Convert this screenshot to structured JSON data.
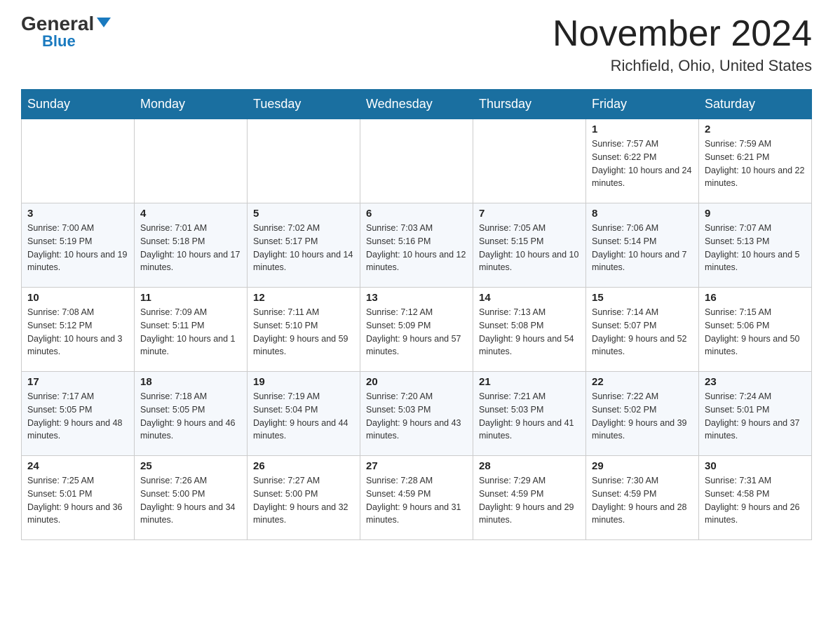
{
  "header": {
    "logo_text_general": "General",
    "logo_text_blue": "Blue",
    "page_title": "November 2024",
    "subtitle": "Richfield, Ohio, United States"
  },
  "calendar": {
    "days_of_week": [
      "Sunday",
      "Monday",
      "Tuesday",
      "Wednesday",
      "Thursday",
      "Friday",
      "Saturday"
    ],
    "weeks": [
      [
        {
          "day": "",
          "info": ""
        },
        {
          "day": "",
          "info": ""
        },
        {
          "day": "",
          "info": ""
        },
        {
          "day": "",
          "info": ""
        },
        {
          "day": "",
          "info": ""
        },
        {
          "day": "1",
          "info": "Sunrise: 7:57 AM\nSunset: 6:22 PM\nDaylight: 10 hours and 24 minutes."
        },
        {
          "day": "2",
          "info": "Sunrise: 7:59 AM\nSunset: 6:21 PM\nDaylight: 10 hours and 22 minutes."
        }
      ],
      [
        {
          "day": "3",
          "info": "Sunrise: 7:00 AM\nSunset: 5:19 PM\nDaylight: 10 hours and 19 minutes."
        },
        {
          "day": "4",
          "info": "Sunrise: 7:01 AM\nSunset: 5:18 PM\nDaylight: 10 hours and 17 minutes."
        },
        {
          "day": "5",
          "info": "Sunrise: 7:02 AM\nSunset: 5:17 PM\nDaylight: 10 hours and 14 minutes."
        },
        {
          "day": "6",
          "info": "Sunrise: 7:03 AM\nSunset: 5:16 PM\nDaylight: 10 hours and 12 minutes."
        },
        {
          "day": "7",
          "info": "Sunrise: 7:05 AM\nSunset: 5:15 PM\nDaylight: 10 hours and 10 minutes."
        },
        {
          "day": "8",
          "info": "Sunrise: 7:06 AM\nSunset: 5:14 PM\nDaylight: 10 hours and 7 minutes."
        },
        {
          "day": "9",
          "info": "Sunrise: 7:07 AM\nSunset: 5:13 PM\nDaylight: 10 hours and 5 minutes."
        }
      ],
      [
        {
          "day": "10",
          "info": "Sunrise: 7:08 AM\nSunset: 5:12 PM\nDaylight: 10 hours and 3 minutes."
        },
        {
          "day": "11",
          "info": "Sunrise: 7:09 AM\nSunset: 5:11 PM\nDaylight: 10 hours and 1 minute."
        },
        {
          "day": "12",
          "info": "Sunrise: 7:11 AM\nSunset: 5:10 PM\nDaylight: 9 hours and 59 minutes."
        },
        {
          "day": "13",
          "info": "Sunrise: 7:12 AM\nSunset: 5:09 PM\nDaylight: 9 hours and 57 minutes."
        },
        {
          "day": "14",
          "info": "Sunrise: 7:13 AM\nSunset: 5:08 PM\nDaylight: 9 hours and 54 minutes."
        },
        {
          "day": "15",
          "info": "Sunrise: 7:14 AM\nSunset: 5:07 PM\nDaylight: 9 hours and 52 minutes."
        },
        {
          "day": "16",
          "info": "Sunrise: 7:15 AM\nSunset: 5:06 PM\nDaylight: 9 hours and 50 minutes."
        }
      ],
      [
        {
          "day": "17",
          "info": "Sunrise: 7:17 AM\nSunset: 5:05 PM\nDaylight: 9 hours and 48 minutes."
        },
        {
          "day": "18",
          "info": "Sunrise: 7:18 AM\nSunset: 5:05 PM\nDaylight: 9 hours and 46 minutes."
        },
        {
          "day": "19",
          "info": "Sunrise: 7:19 AM\nSunset: 5:04 PM\nDaylight: 9 hours and 44 minutes."
        },
        {
          "day": "20",
          "info": "Sunrise: 7:20 AM\nSunset: 5:03 PM\nDaylight: 9 hours and 43 minutes."
        },
        {
          "day": "21",
          "info": "Sunrise: 7:21 AM\nSunset: 5:03 PM\nDaylight: 9 hours and 41 minutes."
        },
        {
          "day": "22",
          "info": "Sunrise: 7:22 AM\nSunset: 5:02 PM\nDaylight: 9 hours and 39 minutes."
        },
        {
          "day": "23",
          "info": "Sunrise: 7:24 AM\nSunset: 5:01 PM\nDaylight: 9 hours and 37 minutes."
        }
      ],
      [
        {
          "day": "24",
          "info": "Sunrise: 7:25 AM\nSunset: 5:01 PM\nDaylight: 9 hours and 36 minutes."
        },
        {
          "day": "25",
          "info": "Sunrise: 7:26 AM\nSunset: 5:00 PM\nDaylight: 9 hours and 34 minutes."
        },
        {
          "day": "26",
          "info": "Sunrise: 7:27 AM\nSunset: 5:00 PM\nDaylight: 9 hours and 32 minutes."
        },
        {
          "day": "27",
          "info": "Sunrise: 7:28 AM\nSunset: 4:59 PM\nDaylight: 9 hours and 31 minutes."
        },
        {
          "day": "28",
          "info": "Sunrise: 7:29 AM\nSunset: 4:59 PM\nDaylight: 9 hours and 29 minutes."
        },
        {
          "day": "29",
          "info": "Sunrise: 7:30 AM\nSunset: 4:59 PM\nDaylight: 9 hours and 28 minutes."
        },
        {
          "day": "30",
          "info": "Sunrise: 7:31 AM\nSunset: 4:58 PM\nDaylight: 9 hours and 26 minutes."
        }
      ]
    ]
  }
}
